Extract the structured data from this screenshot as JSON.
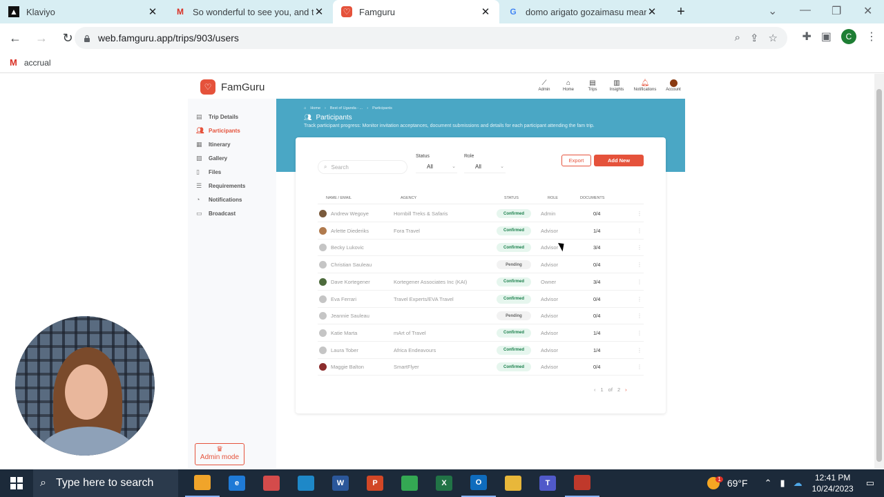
{
  "browser": {
    "tabs": [
      {
        "title": "Klaviyo",
        "favicon": "klaviyo-icon",
        "active": false
      },
      {
        "title": "So wonderful to see you, and the",
        "favicon": "gmail-icon",
        "active": false
      },
      {
        "title": "Famguru",
        "favicon": "famguru-icon",
        "active": true
      },
      {
        "title": "domo arigato gozaimasu meaning",
        "favicon": "google-icon",
        "active": false
      }
    ],
    "url": "web.famguru.app/trips/903/users",
    "profile_initial": "C",
    "bookmark": "accrual"
  },
  "app": {
    "brand": "FamGuru",
    "topnav": [
      {
        "label": "Admin",
        "icon": "chart-line-icon"
      },
      {
        "label": "Home",
        "icon": "home-icon"
      },
      {
        "label": "Trips",
        "icon": "briefcase-icon"
      },
      {
        "label": "Insights",
        "icon": "insights-icon"
      },
      {
        "label": "Notifications",
        "icon": "bell-icon"
      },
      {
        "label": "Account",
        "icon": "avatar"
      }
    ],
    "sidebar": [
      {
        "label": "Trip Details",
        "icon": "briefcase-icon",
        "active": false
      },
      {
        "label": "Participants",
        "icon": "users-icon",
        "active": true
      },
      {
        "label": "Itinerary",
        "icon": "calendar-icon",
        "active": false
      },
      {
        "label": "Gallery",
        "icon": "image-icon",
        "active": false
      },
      {
        "label": "Files",
        "icon": "file-icon",
        "active": false
      },
      {
        "label": "Requirements",
        "icon": "list-icon",
        "active": false
      },
      {
        "label": "Notifications",
        "icon": "bell-icon",
        "active": false
      },
      {
        "label": "Broadcast",
        "icon": "chat-icon",
        "active": false
      }
    ],
    "admin_mode_label": "Admin mode"
  },
  "banner": {
    "breadcrumbs": [
      "Home",
      "Best of Uganda - ...",
      "Participants"
    ],
    "title": "Participants",
    "description": "Track participant progress: Monitor invitation acceptances, document submissions and details for each participant attending the fam trip."
  },
  "toolbar": {
    "search_placeholder": "Search",
    "status_label": "Status",
    "status_value": "All",
    "role_label": "Role",
    "role_value": "All",
    "export_label": "Export",
    "add_label": "Add New"
  },
  "table": {
    "headers": {
      "name": "NAME / EMAIL",
      "agency": "AGENCY",
      "status": "STATUS",
      "role": "ROLE",
      "documents": "DOCUMENTS"
    },
    "rows": [
      {
        "name": "Andrew Wegoye",
        "agency": "Hornbill Treks & Safaris",
        "status": "Confirmed",
        "role": "Admin",
        "documents": "0/4",
        "photo": "photo"
      },
      {
        "name": "Arlette Diederiks",
        "agency": "Fora Travel",
        "status": "Confirmed",
        "role": "Advisor",
        "documents": "1/4",
        "photo": "photo2"
      },
      {
        "name": "Becky Lukovic",
        "agency": "",
        "status": "Confirmed",
        "role": "Advisor",
        "documents": "3/4",
        "photo": ""
      },
      {
        "name": "Christian Sauleau",
        "agency": "",
        "status": "Pending",
        "role": "Advisor",
        "documents": "0/4",
        "photo": ""
      },
      {
        "name": "Dave Kortegener",
        "agency": "Kortegener Associates Inc (KAI)",
        "status": "Confirmed",
        "role": "Owner",
        "documents": "3/4",
        "photo": "photo3"
      },
      {
        "name": "Eva Ferrari",
        "agency": "Travel Experts/EVA Travel",
        "status": "Confirmed",
        "role": "Advisor",
        "documents": "0/4",
        "photo": ""
      },
      {
        "name": "Jeannie Sauleau",
        "agency": "",
        "status": "Pending",
        "role": "Advisor",
        "documents": "0/4",
        "photo": ""
      },
      {
        "name": "Katie Marta",
        "agency": "mArt of Travel",
        "status": "Confirmed",
        "role": "Advisor",
        "documents": "1/4",
        "photo": ""
      },
      {
        "name": "Laura Tober",
        "agency": "Africa Endeavours",
        "status": "Confirmed",
        "role": "Advisor",
        "documents": "1/4",
        "photo": ""
      },
      {
        "name": "Maggie Balton",
        "agency": "SmartFlyer",
        "status": "Confirmed",
        "role": "Advisor",
        "documents": "0/4",
        "photo": "photo4"
      }
    ]
  },
  "pagination": {
    "current": "1",
    "of": "of",
    "total": "2"
  },
  "taskbar": {
    "search_placeholder": "Type here to search",
    "temperature": "69°F",
    "time": "12:41 PM",
    "date": "10/24/2023",
    "weather_badge": "1",
    "apps": [
      {
        "name": "file-explorer-briefcase",
        "color": "#f0a42a",
        "label": "",
        "active": true
      },
      {
        "name": "internet-explorer",
        "color": "#1f7ad6",
        "label": "e",
        "active": false
      },
      {
        "name": "snagit",
        "color": "#d44b4b",
        "label": "",
        "active": false
      },
      {
        "name": "camera-app",
        "color": "#1e88c8",
        "label": "",
        "active": false
      },
      {
        "name": "word",
        "color": "#2b579a",
        "label": "W",
        "active": false
      },
      {
        "name": "powerpoint",
        "color": "#d24726",
        "label": "P",
        "active": false
      },
      {
        "name": "chrome",
        "color": "#34a853",
        "label": "",
        "active": false
      },
      {
        "name": "excel",
        "color": "#217346",
        "label": "X",
        "active": false
      },
      {
        "name": "outlook",
        "color": "#0f6cbd",
        "label": "O",
        "active": true
      },
      {
        "name": "folder",
        "color": "#e8b73a",
        "label": "",
        "active": false
      },
      {
        "name": "teams",
        "color": "#5059c9",
        "label": "T",
        "active": false
      },
      {
        "name": "chrome-2",
        "color": "#c0392b",
        "label": "",
        "active": true
      }
    ]
  }
}
